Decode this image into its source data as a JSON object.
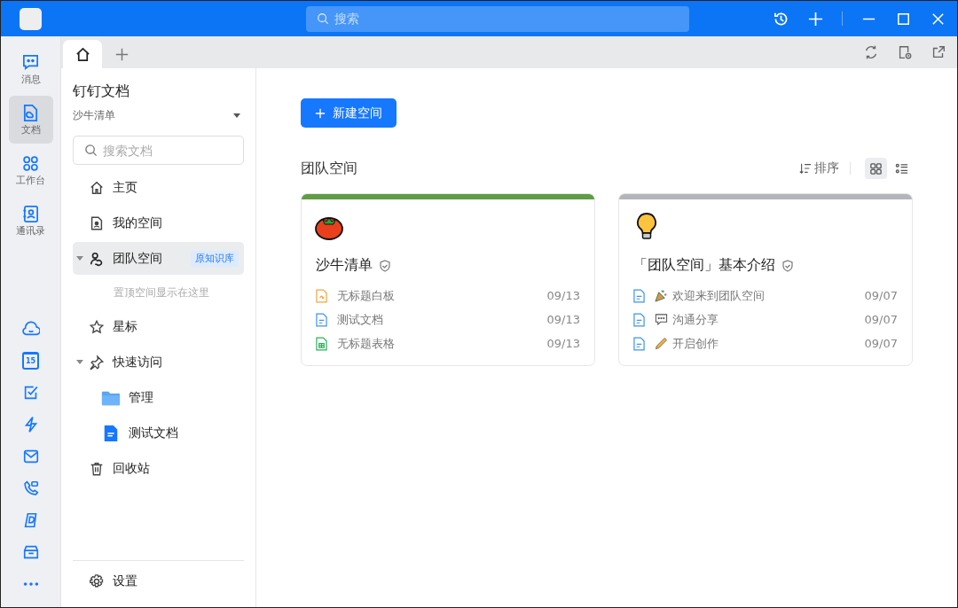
{
  "titlebar": {
    "search": {
      "placeholder": "搜索"
    }
  },
  "rail": {
    "items": [
      {
        "kind": "message",
        "label": "消息",
        "selected": false
      },
      {
        "kind": "docs",
        "label": "文档",
        "selected": true
      },
      {
        "kind": "workbench",
        "label": "工作台",
        "selected": false
      },
      {
        "kind": "contacts",
        "label": "通讯录",
        "selected": false
      }
    ],
    "tools": [
      {
        "kind": "cloud"
      },
      {
        "kind": "calendar",
        "day": "15"
      },
      {
        "kind": "todo"
      },
      {
        "kind": "flash"
      },
      {
        "kind": "mail"
      },
      {
        "kind": "phone"
      },
      {
        "kind": "drive"
      },
      {
        "kind": "box"
      },
      {
        "kind": "more"
      }
    ]
  },
  "tabs": [
    {
      "kind": "home",
      "selected": true
    },
    {
      "kind": "add",
      "selected": false
    }
  ],
  "sidebar": {
    "title": "钉钉文档",
    "workspace": "沙牛清单",
    "search": {
      "placeholder": "搜索文档"
    },
    "items": [
      {
        "kind": "home",
        "label": "主页",
        "selected": false
      },
      {
        "kind": "mine",
        "label": "我的空间",
        "selected": false
      },
      {
        "kind": "team",
        "label": "团队空间",
        "selected": true,
        "expanded": true,
        "badge": "原知识库",
        "hint": "置顶空间显示在这里"
      },
      {
        "kind": "star",
        "label": "星标",
        "selected": false
      },
      {
        "kind": "pin",
        "label": "快速访问",
        "selected": false,
        "expanded": true,
        "children": [
          {
            "kind": "folder",
            "label": "管理"
          },
          {
            "kind": "doc",
            "label": "测试文档"
          }
        ]
      },
      {
        "kind": "trash",
        "label": "回收站",
        "selected": false
      }
    ],
    "footer": "设置"
  },
  "main": {
    "new_button": "新建空间",
    "section_title": "团队空间",
    "sort": "排序",
    "views": [
      {
        "kind": "grid",
        "selected": true
      },
      {
        "kind": "list",
        "selected": false
      }
    ],
    "cards": [
      {
        "kind": "tomato",
        "color": "#5f9c45",
        "title": "沙牛清单",
        "files": [
          {
            "kind": "whiteboard",
            "name": "无标题白板",
            "date": "09/13"
          },
          {
            "kind": "doc",
            "name": "测试文档",
            "date": "09/13"
          },
          {
            "kind": "sheet",
            "name": "无标题表格",
            "date": "09/13"
          }
        ]
      },
      {
        "kind": "bulb",
        "color": "#b4b5bb",
        "title": "「团队空间」基本介绍",
        "files": [
          {
            "kind": "doc_party",
            "name": "欢迎来到团队空间",
            "date": "09/07"
          },
          {
            "kind": "doc_speech",
            "name": "沟通分享",
            "date": "09/07"
          },
          {
            "kind": "doc_pencil",
            "name": "开启创作",
            "date": "09/07"
          }
        ]
      }
    ]
  }
}
